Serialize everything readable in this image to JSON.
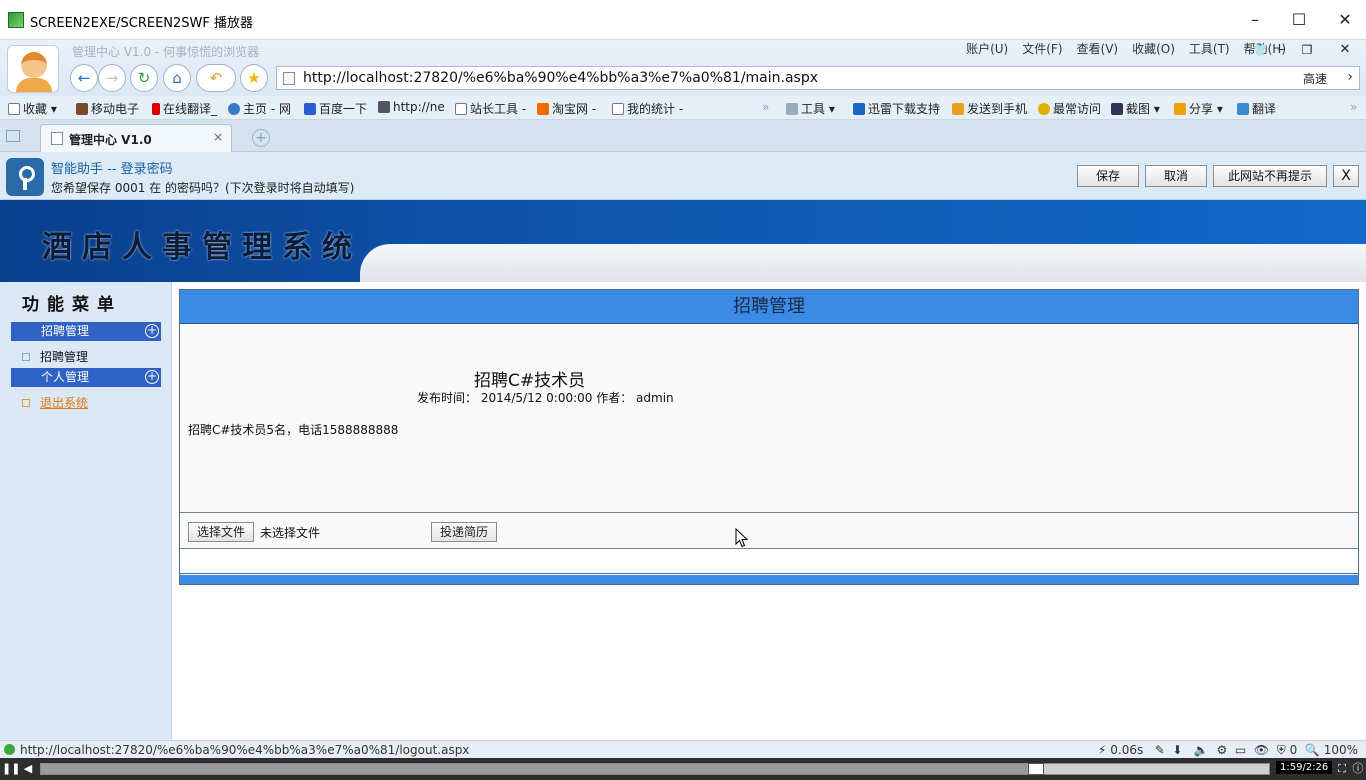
{
  "player": {
    "title": "SCREEN2EXE/SCREEN2SWF 播放器",
    "time": "1:59/2:26",
    "progress": 0.81
  },
  "browser": {
    "faded_title": "管理中心 V1.0 - 何事惊慌的浏览器",
    "menu": [
      "账户(U)",
      "文件(F)",
      "查看(V)",
      "收藏(O)",
      "工具(T)",
      "帮助(H)"
    ],
    "url": "http://localhost:27820/%e6%ba%90%e4%bb%a3%e7%a0%81/main.aspx",
    "speed_label": "高速",
    "bookmarks_left": [
      "收藏",
      "移动电子",
      "在线翻译_",
      "主页 - 网",
      "百度一下",
      "http://ne",
      "站长工具 -",
      "淘宝网 -",
      "我的统计 -"
    ],
    "bookmarks_right": [
      "工具",
      "迅雷下载支持",
      "发送到手机",
      "最常访问",
      "截图",
      "分享",
      "翻译"
    ],
    "tab_label": "管理中心 V1.0",
    "tab_close": "×",
    "new_tab": "+"
  },
  "password_bar": {
    "title": "智能助手 -- 登录密码",
    "message": "您希望保存 0001 在  的密码吗？(下次登录时将自动填写)",
    "save": "保存",
    "cancel": "取消",
    "never": "此网站不再提示",
    "close": "X"
  },
  "page": {
    "system_title": "酒店人事管理系统",
    "menu_title": "功能菜单",
    "menu": {
      "section1": "招聘管理",
      "item1": "招聘管理",
      "section2": "个人管理",
      "item2": "退出系统"
    },
    "panel_title": "招聘管理",
    "post": {
      "title": "招聘C#技术员",
      "meta": "发布时间：  2014/5/12 0:00:00 作者：  admin",
      "body": "招聘C#技术员5名，电话1588888888"
    },
    "upload": {
      "choose_file": "选择文件",
      "no_file": "未选择文件",
      "submit": "投递简历"
    }
  },
  "status": {
    "url": "http://localhost:27820/%e6%ba%90%e4%bb%a3%e7%a0%81/logout.aspx",
    "timing": "0.06s",
    "count": "0",
    "zoom": "100%"
  }
}
